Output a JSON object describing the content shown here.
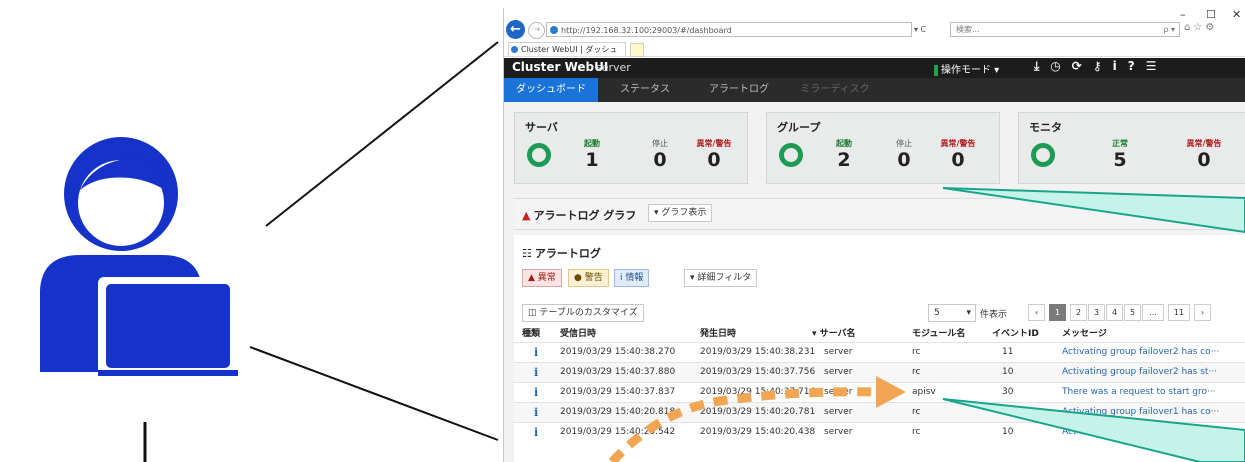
{
  "browser": {
    "url": "http://192.168.32.100:29003/#/dashboard",
    "url_controls": "▾ C",
    "search_placeholder": "検索...",
    "search_icon": "ρ ▾",
    "toolbar_icons": "⌂☆⚙",
    "min_icon": "–",
    "max_icon": "☐",
    "close_icon": "✕",
    "tab_title": "Cluster WebUI | ダッシュボード",
    "tab_close": "×"
  },
  "app": {
    "title": "Cluster WebUI",
    "server": "server",
    "mode_label": "操作モード ▾",
    "header_icons": [
      "download-icon",
      "clock-icon",
      "refresh-icon",
      "key-icon",
      "info-icon",
      "help-icon",
      "menu-icon"
    ],
    "header_icon_glyphs": "⤓◷⟳⚷i?☰"
  },
  "nav": {
    "tabs": [
      {
        "label": "ダッシュボード",
        "active": true,
        "disabled": false
      },
      {
        "label": "ステータス",
        "active": false,
        "disabled": false
      },
      {
        "label": "アラートログ",
        "active": false,
        "disabled": false
      },
      {
        "label": "ミラーディスク",
        "active": false,
        "disabled": true
      }
    ]
  },
  "cards": {
    "server": {
      "title": "サーバ",
      "stats": [
        {
          "label": "起動",
          "value": "1"
        },
        {
          "label": "停止",
          "value": "0"
        },
        {
          "label": "異常/警告",
          "value": "0"
        }
      ]
    },
    "group": {
      "title": "グループ",
      "stats": [
        {
          "label": "起動",
          "value": "2"
        },
        {
          "label": "停止",
          "value": "0"
        },
        {
          "label": "異常/警告",
          "value": "0"
        }
      ]
    },
    "monitor": {
      "title": "モニタ",
      "stats": [
        {
          "label": "正常",
          "value": "5"
        },
        {
          "label": "異常/警告",
          "value": "0"
        }
      ]
    }
  },
  "graph": {
    "title": "アラートログ グラフ",
    "toggle_label": "▾ グラフ表示"
  },
  "alertlog": {
    "title": "アラートログ",
    "filters": {
      "error": "異常",
      "warning": "警告",
      "info": "情報"
    },
    "detail_filter": "▾ 詳細フィルタ",
    "customize": "テーブルのカスタマイズ",
    "page_size": "5",
    "page_size_suffix": "件表示",
    "pages": [
      "‹",
      "1",
      "2",
      "3",
      "4",
      "5",
      "...",
      "11",
      "›"
    ],
    "columns": [
      "種類",
      "受信日時",
      "発生日時",
      "▾ サーバ名",
      "モジュール名",
      "イベントID",
      "メッセージ"
    ],
    "rows": [
      {
        "type": "i",
        "received": "2019/03/29 15:40:38.270",
        "occurred": "2019/03/29 15:40:38.231",
        "server": "server",
        "module": "rc",
        "event_id": "11",
        "message": "Activating group failover2 has co···"
      },
      {
        "type": "i",
        "received": "2019/03/29 15:40:37.880",
        "occurred": "2019/03/29 15:40:37.756",
        "server": "server",
        "module": "rc",
        "event_id": "10",
        "message": "Activating group failover2 has st···"
      },
      {
        "type": "i",
        "received": "2019/03/29 15:40:37.837",
        "occurred": "2019/03/29 15:40:37.714",
        "server": "server",
        "module": "apisv",
        "event_id": "30",
        "message": "There was a request to start gro···"
      },
      {
        "type": "i",
        "received": "2019/03/29 15:40:20.818",
        "occurred": "2019/03/29 15:40:20.781",
        "server": "server",
        "module": "rc",
        "event_id": "11",
        "message": "Activating group failover1 has co···"
      },
      {
        "type": "i",
        "received": "2019/03/29 15:40:20.542",
        "occurred": "2019/03/29 15:40:20.438",
        "server": "server",
        "module": "rc",
        "event_id": "10",
        "message": "Act···"
      }
    ]
  },
  "colors": {
    "nav_active": "#1a73d8",
    "header_bg": "#1c1c1c",
    "ring_green": "#1d9a54",
    "callout_teal": "#1aa58a",
    "callout_fill": "#c5f3ea",
    "arrow_orange": "#f2a654",
    "person_blue": "#1533c9"
  }
}
